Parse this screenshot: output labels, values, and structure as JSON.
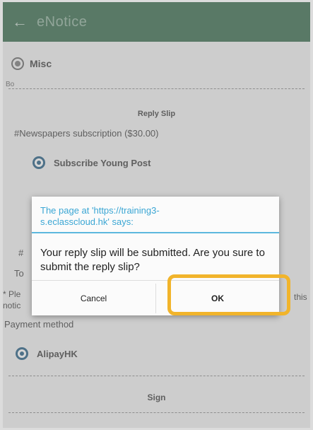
{
  "appbar": {
    "back_icon": "arrow-left-icon",
    "title": "eNotice"
  },
  "content": {
    "misc_label": "Misc",
    "misc_sub": "Bo",
    "reply_slip_title": "Reply Slip",
    "question": "#Newspapers subscription ($30.00)",
    "option_1": "Subscribe Young Post",
    "partial_hash": "#",
    "partial_to": "To",
    "partial_ple": "* Ple",
    "partial_notic": "notic",
    "partial_this": "this",
    "payment_method_label": "Payment method",
    "payment_option": "AlipayHK",
    "sign_label": "Sign"
  },
  "dialog": {
    "title": "The page at 'https://training3-s.eclasscloud.hk' says:",
    "message": "Your reply slip will be submitted. Are you sure to submit the reply slip?",
    "cancel_label": "Cancel",
    "ok_label": "OK"
  },
  "colors": {
    "appbar": "#4c7a5f",
    "dialog_title": "#3aa6d4",
    "highlight": "#f1b42b",
    "radio": "#3d6f90"
  }
}
